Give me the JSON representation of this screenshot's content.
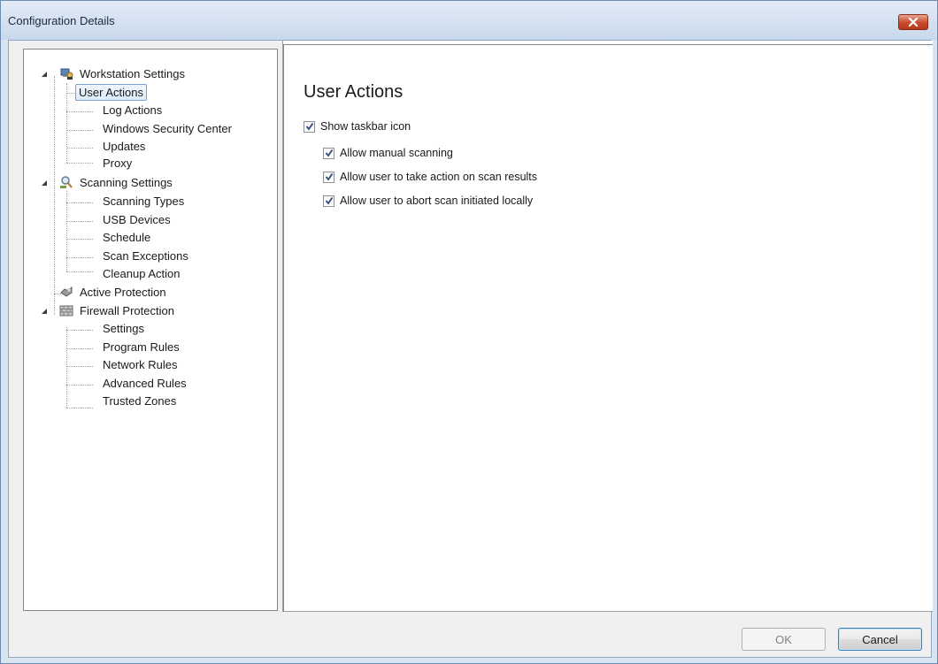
{
  "window": {
    "title": "Configuration Details"
  },
  "tree": {
    "nodes": [
      {
        "label": "Workstation Settings",
        "icon": "workstation-icon",
        "children": [
          "User Actions",
          "Log Actions",
          "Windows Security Center",
          "Updates",
          "Proxy"
        ]
      },
      {
        "label": "Scanning Settings",
        "icon": "scanning-icon",
        "children": [
          "Scanning Types",
          "USB Devices",
          "Schedule",
          "Scan Exceptions",
          "Cleanup Action"
        ]
      },
      {
        "label": "Active Protection",
        "icon": "active-protection-icon",
        "children": []
      },
      {
        "label": "Firewall Protection",
        "icon": "firewall-icon",
        "children": [
          "Settings",
          "Program Rules",
          "Network Rules",
          "Advanced Rules",
          "Trusted Zones"
        ]
      }
    ],
    "selected": "User Actions"
  },
  "content": {
    "heading": "User Actions",
    "options": [
      {
        "label": "Show taskbar icon",
        "checked": true,
        "indent": 0
      },
      {
        "label": "Allow manual scanning",
        "checked": true,
        "indent": 1
      },
      {
        "label": "Allow user to take action on scan results",
        "checked": true,
        "indent": 1
      },
      {
        "label": "Allow user to abort scan initiated locally",
        "checked": true,
        "indent": 1
      }
    ]
  },
  "buttons": {
    "ok": "OK",
    "cancel": "Cancel"
  },
  "colors": {
    "selection_border": "#7da2ce",
    "selection_fill": "#dcebfc",
    "titlebar": "#c8d8ec",
    "close_button": "#c94a2c"
  }
}
